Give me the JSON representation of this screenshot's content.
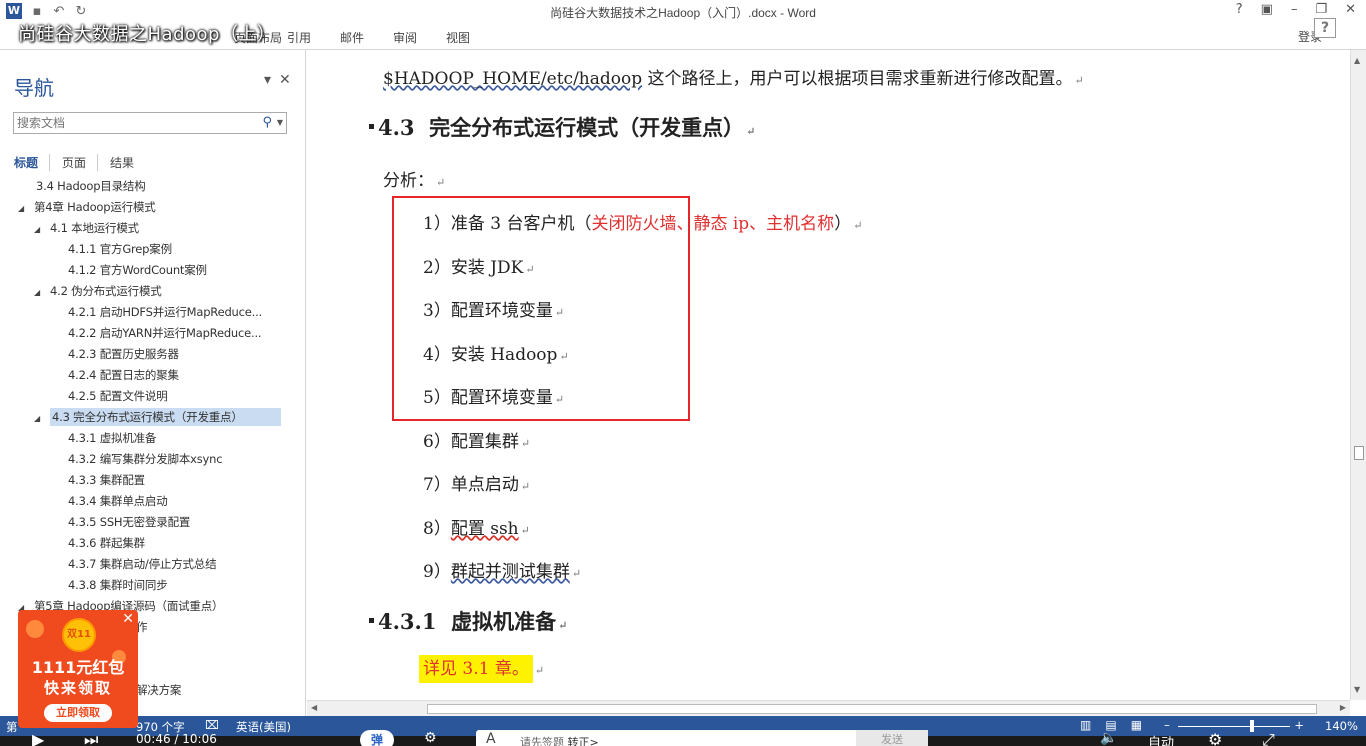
{
  "window": {
    "doc_title": "尚硅谷大数据技术之Hadoop（入门）.docx - Word",
    "window_controls": [
      "?",
      "▣",
      "–",
      "❐",
      "✕"
    ]
  },
  "video_title": "尚硅谷大数据之Hadoop（上）",
  "ribbon": {
    "tabs": [
      "页面布局",
      "引用",
      "邮件",
      "审阅",
      "视图"
    ],
    "login": "登录"
  },
  "help_button": "?",
  "nav": {
    "header": "导航",
    "search_placeholder": "搜索文档",
    "tabs": [
      "标题",
      "页面",
      "结果"
    ],
    "items": [
      {
        "label": "3.4 Hadoop目录结构",
        "arrow": ""
      },
      {
        "label": "第4章 Hadoop运行模式",
        "arrow": "◢"
      },
      {
        "label": "4.1 本地运行模式",
        "arrow": "◢"
      },
      {
        "label": "4.1.1 官方Grep案例",
        "arrow": ""
      },
      {
        "label": "4.1.2 官方WordCount案例",
        "arrow": ""
      },
      {
        "label": "4.2 伪分布式运行模式",
        "arrow": "◢"
      },
      {
        "label": "4.2.1 启动HDFS并运行MapReduce...",
        "arrow": ""
      },
      {
        "label": "4.2.2 启动YARN并运行MapReduce...",
        "arrow": ""
      },
      {
        "label": "4.2.3 配置历史服务器",
        "arrow": ""
      },
      {
        "label": "4.2.4 配置日志的聚集",
        "arrow": ""
      },
      {
        "label": "4.2.5 配置文件说明",
        "arrow": ""
      },
      {
        "label": "4.3 完全分布式运行模式（开发重点）",
        "arrow": "◢"
      },
      {
        "label": "4.3.1 虚拟机准备",
        "arrow": ""
      },
      {
        "label": "4.3.2 编写集群分发脚本xsync",
        "arrow": ""
      },
      {
        "label": "4.3.3 集群配置",
        "arrow": ""
      },
      {
        "label": "4.3.4 集群单点启动",
        "arrow": ""
      },
      {
        "label": "4.3.5 SSH无密登录配置",
        "arrow": ""
      },
      {
        "label": "4.3.6 群起集群",
        "arrow": ""
      },
      {
        "label": "4.3.7 集群启动/停止方式总结",
        "arrow": ""
      },
      {
        "label": "4.3.8 集群时间同步",
        "arrow": ""
      },
      {
        "label": "第5章 Hadoop编译源码（面试重点）",
        "arrow": "◢"
      },
      {
        "label": "作",
        "arrow": ""
      },
      {
        "label": "解决方案",
        "arrow": ""
      }
    ]
  },
  "document": {
    "line1_path": "$HADOOP_HOME/etc/hadoop",
    "line1_rest": " 这个路径上，用户可以根据项目需求重新进行修改配置。",
    "heading_43_num": "4.3",
    "heading_43_text": "完全分布式运行模式（开发重点）",
    "analysis": "分析：",
    "steps": [
      {
        "num": "1）",
        "text": "准备 3 台客户机（",
        "red": "关闭防火墙、静态 ip、主机名称",
        "tail": "）"
      },
      {
        "num": "2）",
        "text": "安装 JDK",
        "red": "",
        "tail": ""
      },
      {
        "num": "3）",
        "text": "配置环境变量",
        "red": "",
        "tail": ""
      },
      {
        "num": "4）",
        "text": "安装 Hadoop",
        "red": "",
        "tail": ""
      },
      {
        "num": "5）",
        "text": "配置环境变量",
        "red": "",
        "tail": ""
      },
      {
        "num": "6）",
        "text": "配置集群",
        "red": "",
        "tail": ""
      },
      {
        "num": "7）",
        "text": "单点启动",
        "red": "",
        "tail": ""
      },
      {
        "num": "8）",
        "text": "配置 ssh",
        "red": "",
        "tail": ""
      },
      {
        "num": "9）",
        "text": "群起并测试集群",
        "red": "",
        "tail": ""
      }
    ],
    "heading_431_num": "4.3.1",
    "heading_431_text": "虚拟机准备",
    "highlight_text": "详见 3.1 章。",
    "para_mark": "↵"
  },
  "status": {
    "page": "第",
    "words": "970 个字",
    "language": "英语(美国)",
    "zoom": "140%"
  },
  "player": {
    "time": "00:46 / 10:06",
    "danmu_label": "弹",
    "input_icon": "A",
    "input_placeholder": "请先签题",
    "input_link": "转正>",
    "send": "发送",
    "auto": "自动"
  },
  "ad": {
    "amount": "1111元红包",
    "subtitle": "快来领取",
    "button": "立即领取",
    "coin_label": "双11"
  },
  "colors": {
    "word_blue": "#2b579a",
    "red_box": "#e8262a",
    "highlight": "#fff200",
    "red_text": "#e03030",
    "ad_orange": "#f04a1f"
  }
}
